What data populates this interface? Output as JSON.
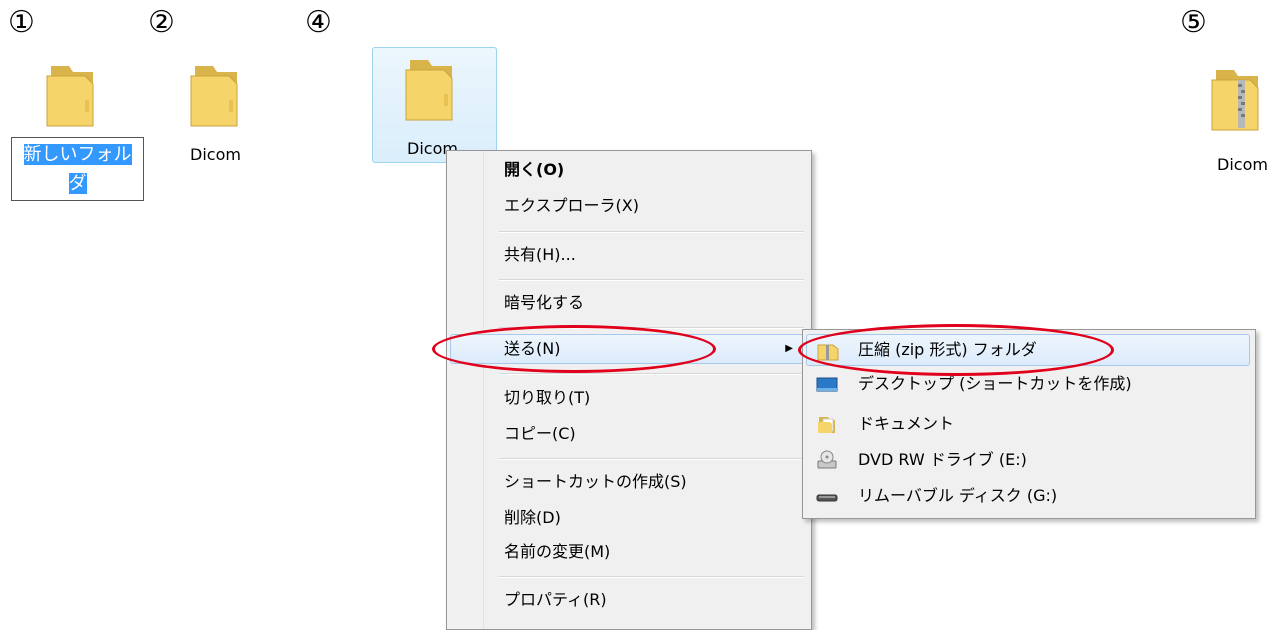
{
  "steps": {
    "s1": "①",
    "s2": "②",
    "s4": "④",
    "s5": "⑤"
  },
  "icons": {
    "rename_line1": "新しいフォル",
    "rename_line2": "ダ",
    "folder2_label": "Dicom",
    "folder4_label": "Dicom",
    "zip_label": "Dicom"
  },
  "context_menu": {
    "items": [
      "開く(O)",
      "エクスプローラ(X)",
      "共有(H)...",
      "暗号化する",
      "送る(N)",
      "切り取り(T)",
      "コピー(C)",
      "ショートカットの作成(S)",
      "削除(D)",
      "名前の変更(M)",
      "プロパティ(R)"
    ],
    "submenu_arrow": "▶"
  },
  "send_to_menu": {
    "items": [
      {
        "label": "圧縮 (zip 形式) フォルダ",
        "icon": "zip-folder-icon"
      },
      {
        "label": "デスクトップ (ショートカットを作成)",
        "icon": "desktop-icon"
      },
      {
        "label": "ドキュメント",
        "icon": "documents-folder-icon"
      },
      {
        "label": "DVD RW ドライブ (E:)",
        "icon": "dvd-drive-icon"
      },
      {
        "label": "リムーバブル ディスク (G:)",
        "icon": "removable-disk-icon"
      }
    ]
  },
  "colors": {
    "highlight": "#3399ff",
    "annotation": "#e0001b",
    "folder": "#f5d46a"
  }
}
